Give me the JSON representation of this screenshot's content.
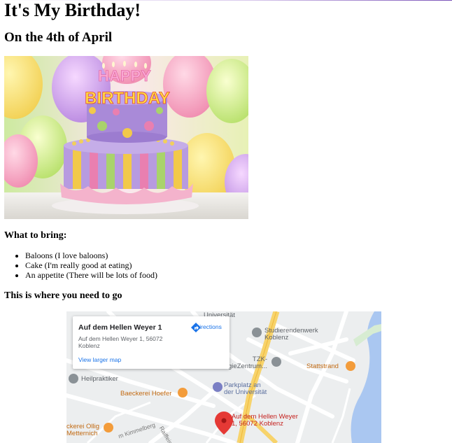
{
  "heading": "It's My Birthday!",
  "subheading": "On the 4th of April",
  "bring_heading": "What to bring:",
  "bring_items": [
    "Baloons (I love baloons)",
    "Cake (I'm really good at eating)",
    "An appetite (There will be lots of food)"
  ],
  "go_heading": "This is where you need to go",
  "cake_text": {
    "line1": "HAPPY",
    "line2": "BIRTHDAY"
  },
  "map": {
    "card": {
      "title": "Auf dem Hellen Weyer 1",
      "address": "Auf dem Hellen Weyer 1, 56072 Koblenz",
      "directions": "Directions",
      "larger_map": "View larger map"
    },
    "places": {
      "universitat": "Universität",
      "studierendenwerk": "Studierendenwerk\nKoblenz",
      "tzk": "TZK-\nTechnologieZentrum...",
      "stattstrand": "Stattstrand",
      "heilpraktiker": "Heilpraktiker",
      "parkplatz": "Parkplatz an\nder Universität",
      "baeckerei_hoefer": "Baeckerei Hoefer",
      "marker": "Auf dem Hellen Weyer\n1, 56072 Koblenz",
      "baeckerei_ollig": "ckerei Ollig\nMetternich",
      "kimmelberg": "m Kimmelberg",
      "raiffeisen": "Raiffeis"
    }
  },
  "colors": {
    "water": "#aac7f1",
    "road_yellow": "#f7d36b",
    "map_bg": "#eceeef",
    "marker_red": "#e53935",
    "link_blue": "#1a73e8"
  }
}
